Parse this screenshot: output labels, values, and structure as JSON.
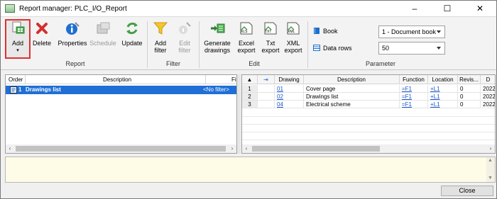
{
  "window": {
    "title": "Report manager: PLC_I/O_Report",
    "minimize": "–",
    "maximize": "☐",
    "close": "✕"
  },
  "ribbon": {
    "buttons": {
      "add": "Add",
      "delete": "Delete",
      "properties": "Properties",
      "schedule": "Schedule",
      "update": "Update",
      "add_filter_1": "Add",
      "add_filter_2": "filter",
      "edit_filter_1": "Edit",
      "edit_filter_2": "filter",
      "gen_1": "Generate",
      "gen_2": "drawings",
      "excel_1": "Excel",
      "excel_2": "export",
      "txt_1": "Txt",
      "txt_2": "export",
      "xml_1": "XML",
      "xml_2": "export"
    },
    "icon_text": {
      "xls": "XLS",
      "txt": "TXT",
      "xml": "XML"
    },
    "groups": {
      "report": "Report",
      "filter": "Filter",
      "edit": "Edit",
      "parameter": "Parameter"
    },
    "parameter": {
      "book_label": "Book",
      "data_rows_label": "Data rows",
      "book_value": "1 - Document book",
      "data_rows_value": "50"
    }
  },
  "tree": {
    "headers": {
      "order": "Order",
      "description": "Description",
      "filter": "Fi"
    },
    "row": {
      "order": "1",
      "description": "Drawings list",
      "filter": "<No filter>"
    }
  },
  "grid": {
    "headers": {
      "drawing": "Drawing",
      "description": "Description",
      "function": "Function",
      "location": "Location",
      "revision": "Revis...",
      "date": "D"
    },
    "rows": [
      {
        "num": "1",
        "drawing": "01",
        "description": "Cover page",
        "function": "=F1",
        "location": "+L1",
        "revision": "0",
        "date": "2022."
      },
      {
        "num": "2",
        "drawing": "02",
        "description": "Drawings list",
        "function": "=F1",
        "location": "+L1",
        "revision": "0",
        "date": "2022."
      },
      {
        "num": "3",
        "drawing": "04",
        "description": "Electrical scheme",
        "function": "=F1",
        "location": "+L1",
        "revision": "0",
        "date": "2022."
      }
    ]
  },
  "footer": {
    "close_label": "Close"
  },
  "colors": {
    "accent": "#1f6fd6",
    "highlight_border": "#e03030",
    "message_bg": "#fefbe6"
  }
}
